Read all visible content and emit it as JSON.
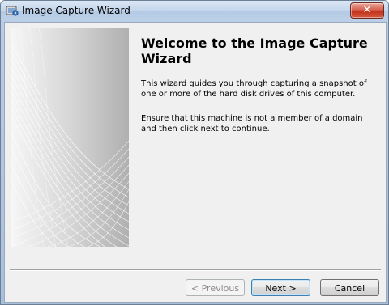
{
  "window": {
    "title": "Image Capture Wizard",
    "close_glyph": "✕"
  },
  "wizard": {
    "heading": "Welcome to the Image Capture Wizard",
    "paragraph1": "This wizard guides you through capturing a snapshot of one or more of the hard disk drives of this computer.",
    "paragraph2": "Ensure that this machine is not a member of a domain and then click next to continue."
  },
  "buttons": {
    "previous_label": "< Previous",
    "next_label": "Next >",
    "cancel_label": "Cancel"
  },
  "icons": {
    "app": "camera-disk-icon",
    "close": "close-icon"
  },
  "colors": {
    "close_button": "#c9432c",
    "titlebar": "#c4d6ec",
    "dialog_background": "#f0f0f0"
  }
}
